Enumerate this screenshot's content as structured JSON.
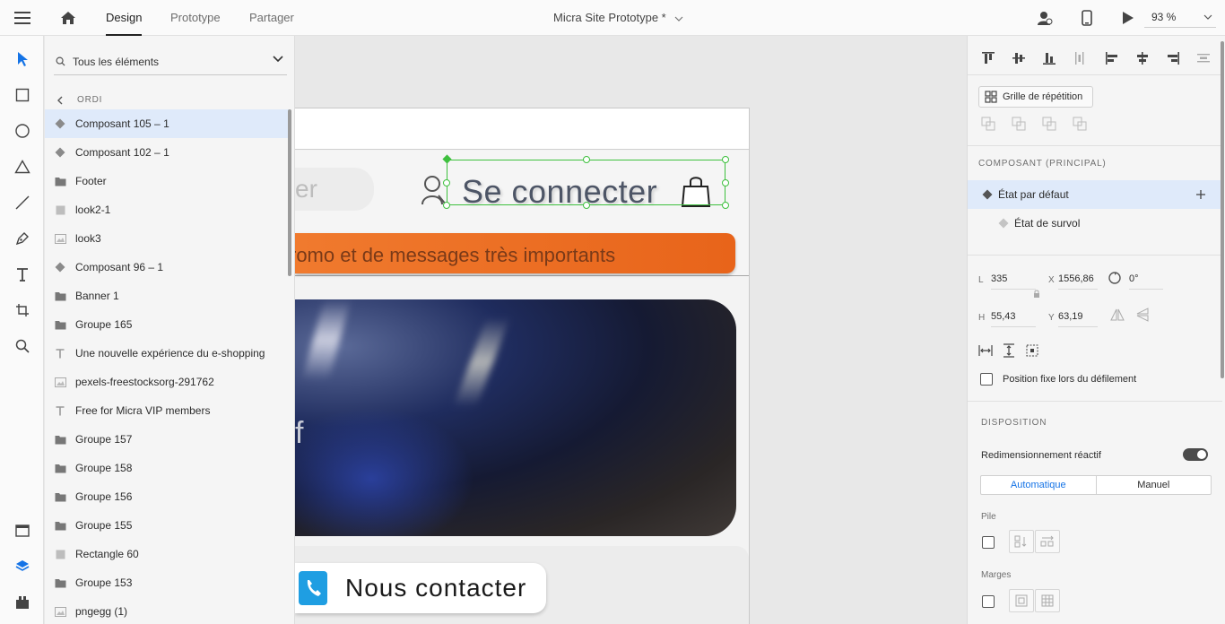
{
  "topbar": {
    "tabs": [
      {
        "label": "Design",
        "active": true
      },
      {
        "label": "Prototype",
        "active": false
      },
      {
        "label": "Partager",
        "active": false
      }
    ],
    "doc_title": "Micra Site Prototype *",
    "zoom": "93 %"
  },
  "layers": {
    "filter_label": "Tous les éléments",
    "breadcrumb": "ORDI",
    "items": [
      {
        "label": "Composant 105 – 1",
        "icon": "component-icon",
        "selected": true
      },
      {
        "label": "Composant 102 – 1",
        "icon": "component-icon"
      },
      {
        "label": "Footer",
        "icon": "folder-icon"
      },
      {
        "label": "look2-1",
        "icon": "rectangle-icon"
      },
      {
        "label": "look3",
        "icon": "image-icon"
      },
      {
        "label": "Composant 96 – 1",
        "icon": "component-icon"
      },
      {
        "label": "Banner 1",
        "icon": "folder-icon"
      },
      {
        "label": "Groupe 165",
        "icon": "folder-icon"
      },
      {
        "label": "Une nouvelle expérience du  e-shopping",
        "icon": "text-icon"
      },
      {
        "label": "pexels-freestocksorg-291762",
        "icon": "image-icon"
      },
      {
        "label": "Free for Micra VIP members",
        "icon": "text-icon"
      },
      {
        "label": "Groupe 157",
        "icon": "folder-icon"
      },
      {
        "label": "Groupe 158",
        "icon": "folder-icon"
      },
      {
        "label": "Groupe 156",
        "icon": "folder-icon"
      },
      {
        "label": "Groupe 155",
        "icon": "folder-icon"
      },
      {
        "label": "Rectangle 60",
        "icon": "rectangle-icon"
      },
      {
        "label": "Groupe 153",
        "icon": "folder-icon"
      },
      {
        "label": "pngegg (1)",
        "icon": "image-icon"
      }
    ]
  },
  "canvas": {
    "search_text": "er",
    "connect_text": "Se connecter",
    "promo_text": "romo et de messages très importants",
    "hero_letter": "f",
    "contact_text": "Nous contacter"
  },
  "props": {
    "repeat_grid": "Grille de répétition",
    "component_title": "COMPOSANT (PRINCIPAL)",
    "states": [
      {
        "label": "État par défaut",
        "selected": true
      },
      {
        "label": "État de survol",
        "selected": false
      }
    ],
    "fields": {
      "w_label": "L",
      "w_value": "335",
      "x_label": "X",
      "x_value": "1556,86",
      "rot_value": "0°",
      "h_label": "H",
      "h_value": "55,43",
      "y_label": "Y",
      "y_value": "63,19"
    },
    "fixed_label": "Position fixe lors du défilement",
    "layout_title": "DISPOSITION",
    "responsive_label": "Redimensionnement réactif",
    "seg_auto": "Automatique",
    "seg_manual": "Manuel",
    "stack_label": "Pile",
    "margins_label": "Marges"
  },
  "colors": {
    "accent": "#1473e6",
    "selection": "#3ec03e",
    "promo": "#e8641a",
    "selected_row": "#dfeafa"
  }
}
